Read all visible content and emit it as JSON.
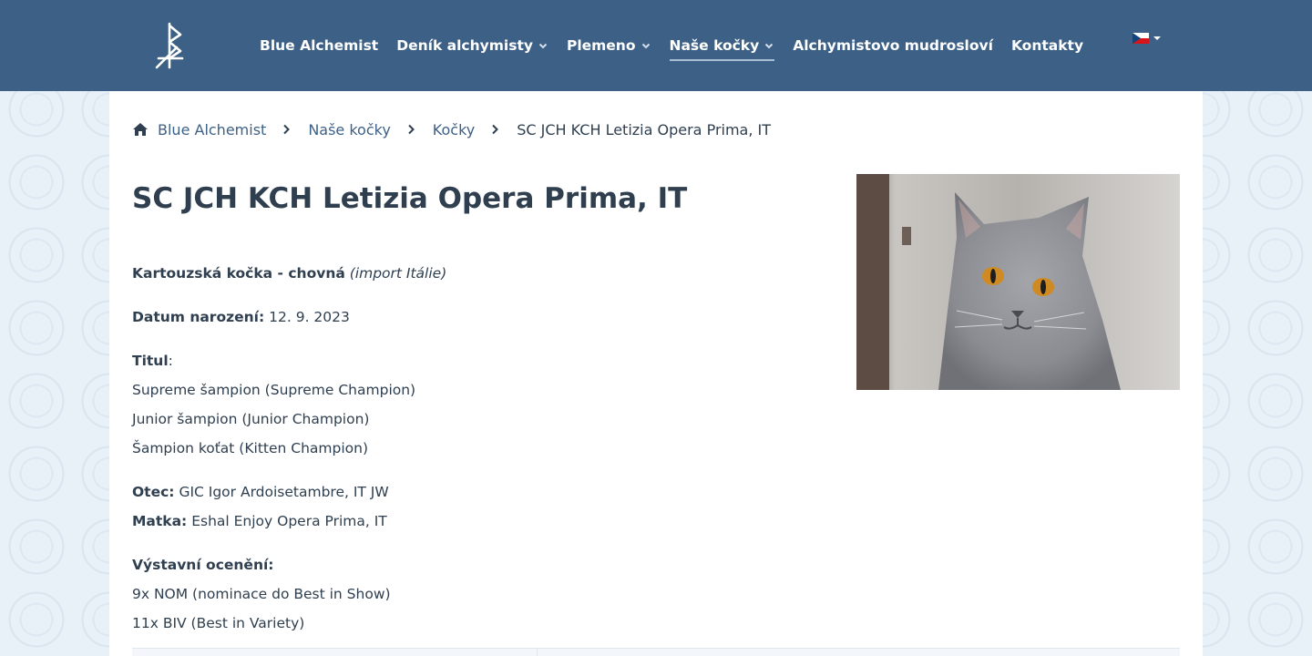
{
  "nav": {
    "items": [
      {
        "label": "Blue Alchemist"
      },
      {
        "label": "Deník alchymisty"
      },
      {
        "label": "Plemeno"
      },
      {
        "label": "Naše kočky"
      },
      {
        "label": "Alchymistovo mudrosloví"
      },
      {
        "label": "Kontakty"
      }
    ]
  },
  "breadcrumb": {
    "home": "Blue Alchemist",
    "level2": "Naše kočky",
    "level3": "Kočky",
    "current": "SC JCH KCH Letizia Opera Prima, IT"
  },
  "page": {
    "title": "SC JCH KCH Letizia Opera Prima, IT"
  },
  "cat": {
    "breed": "Kartouzská kočka - chovná",
    "origin": "(import Itálie)",
    "birth_label": "Datum narození:",
    "birth_value": "12. 9. 2023",
    "title_label": "Titul",
    "title_colon": ":",
    "titles": [
      "Supreme šampion (Supreme Champion)",
      "Junior šampion (Junior Champion)",
      "Šampion koťat (Kitten Champion)"
    ],
    "father_label": "Otec:",
    "father_value": "GIC Igor Ardoisetambre, IT JW",
    "mother_label": "Matka:",
    "mother_value": "Eshal Enjoy Opera Prima, IT",
    "awards_label": "Výstavní ocenění:",
    "awards": [
      "9x NOM (nominace do Best in Show)",
      "11x BIV (Best in Variety)"
    ]
  },
  "colors": {
    "header_bg": "#3d6186",
    "link": "#3d6186",
    "text": "#2f3f4f",
    "page_bg": "#e8f0f8"
  }
}
